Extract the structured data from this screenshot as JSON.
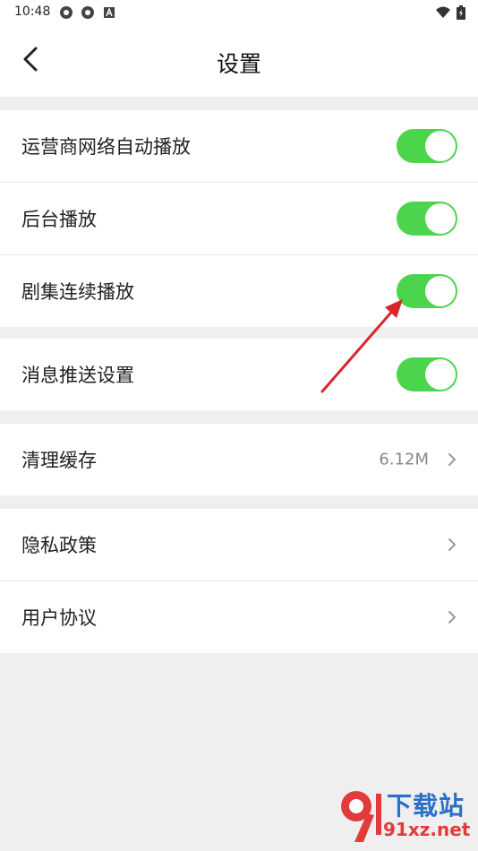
{
  "status_bar": {
    "time": "10:48"
  },
  "header": {
    "title": "设置"
  },
  "groups": [
    {
      "items": [
        {
          "label": "运营商网络自动播放",
          "toggle": true
        },
        {
          "label": "后台播放",
          "toggle": true
        },
        {
          "label": "剧集连续播放",
          "toggle": true
        }
      ]
    },
    {
      "items": [
        {
          "label": "消息推送设置",
          "toggle": true
        }
      ]
    },
    {
      "items": [
        {
          "label": "清理缓存",
          "value": "6.12M"
        }
      ]
    },
    {
      "items": [
        {
          "label": "隐私政策"
        },
        {
          "label": "用户协议"
        }
      ]
    }
  ],
  "colors": {
    "toggle_on": "#4cd44c",
    "background": "#efefef",
    "annotation_arrow": "#d9262a"
  },
  "watermark": {
    "brand": "下载站",
    "url": "91xz.net"
  }
}
